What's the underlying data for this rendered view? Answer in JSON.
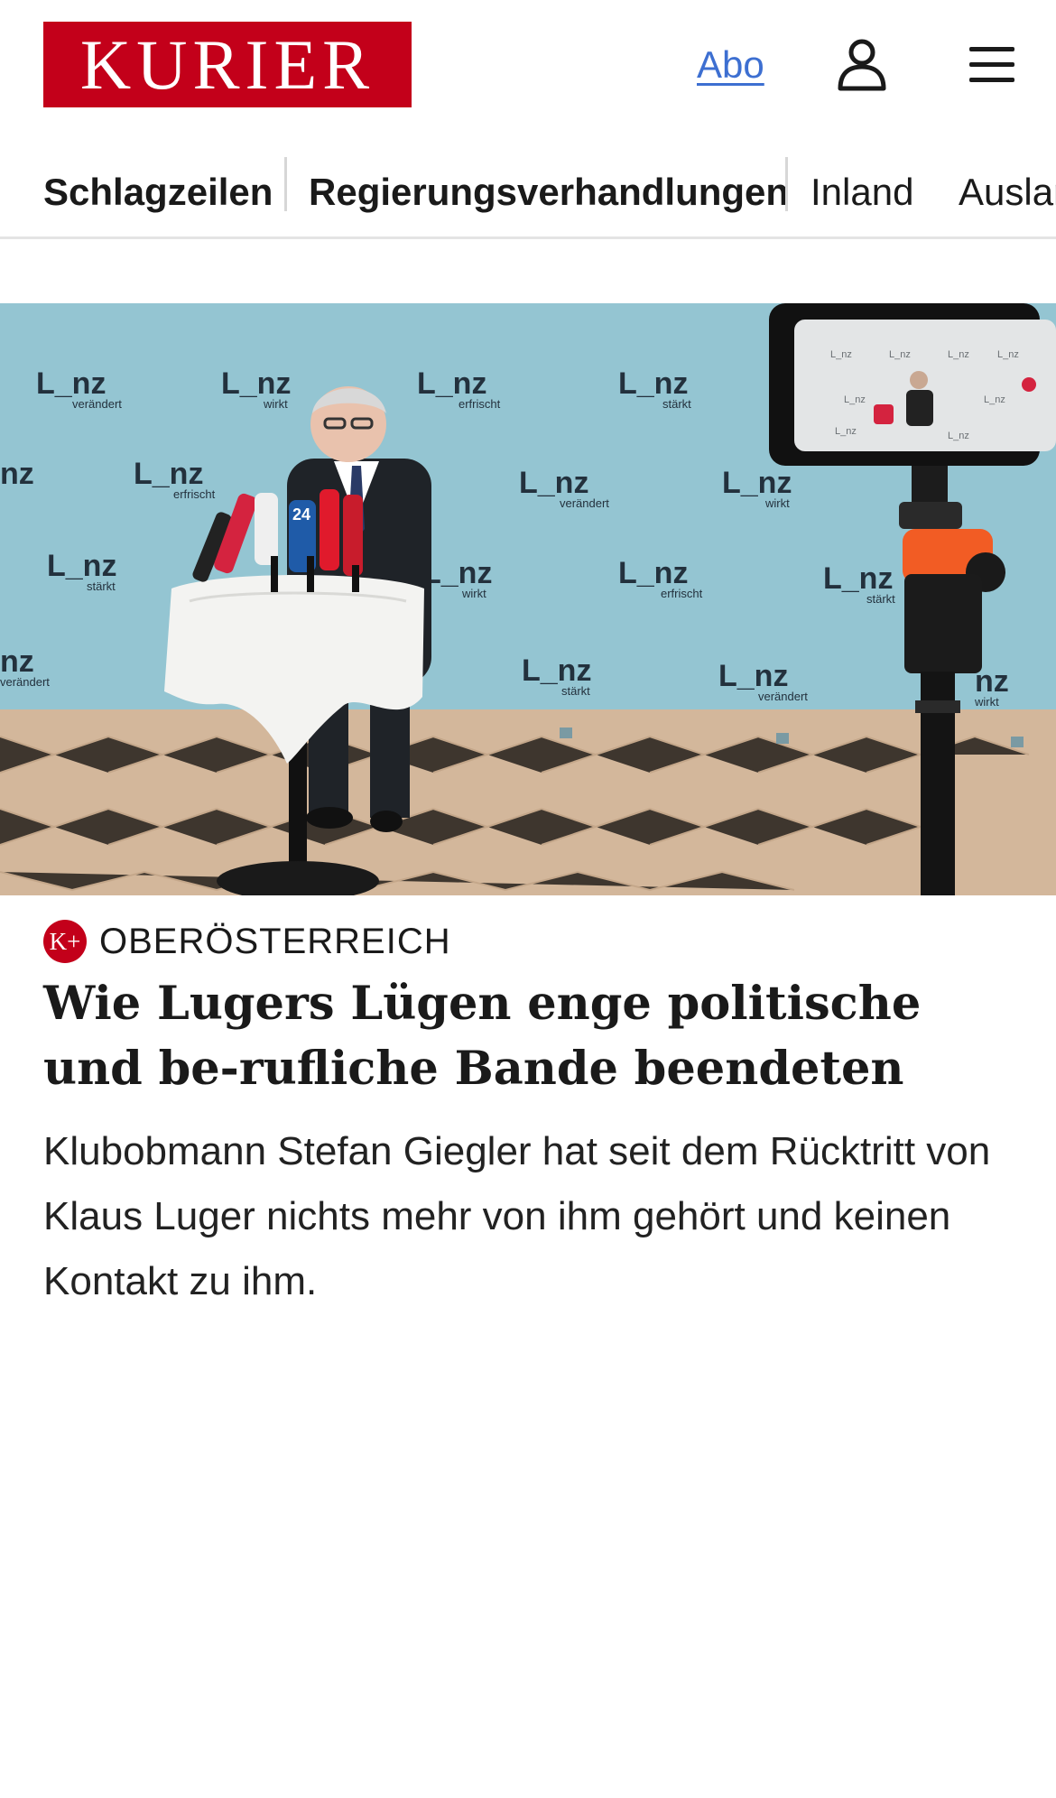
{
  "header": {
    "logo_text": "KURIER",
    "abo_label": "Abo",
    "user_icon": "user-icon",
    "menu_icon": "hamburger-menu-icon"
  },
  "nav": {
    "items": [
      {
        "label": "Schlagzeilen"
      },
      {
        "label": "Regierungsverhandlungen"
      },
      {
        "label": "Inland"
      },
      {
        "label": "Auslan"
      }
    ]
  },
  "article": {
    "kicker_badge": "K+",
    "kicker": "OBERÖSTERREICH",
    "headline": "Wie Lugers Lügen enge politische und be-rufliche Bande beendeten",
    "teaser": "Klubobmann Stefan Giegler hat seit dem Rücktritt von Klaus Luger nichts mehr von ihm gehört und keinen Kontakt zu ihm.",
    "image": {
      "backdrop_words": [
        "verändert",
        "wirkt",
        "erfrischt",
        "stärkt"
      ],
      "backdrop_logo": "L_nz",
      "mic_labels": [
        "24"
      ]
    }
  },
  "colors": {
    "brand": "#c3001a",
    "link": "#3d6fd1",
    "backdrop": "#8fc2cf"
  }
}
